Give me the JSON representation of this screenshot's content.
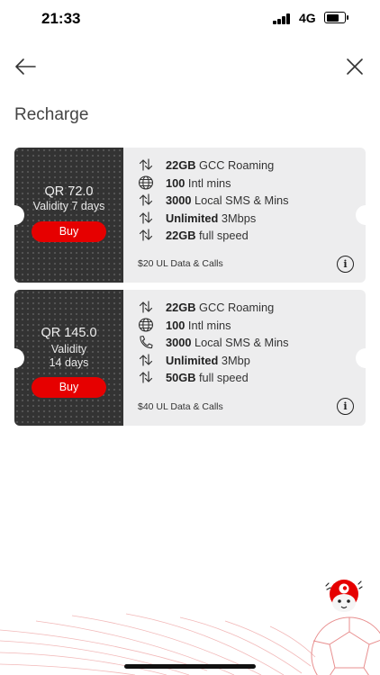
{
  "status_bar": {
    "time": "21:33",
    "network": "4G"
  },
  "header": {
    "title": "Recharge"
  },
  "colors": {
    "accent": "#e60000",
    "card_dark": "#333333",
    "card_light": "#ededee"
  },
  "plans": [
    {
      "price": "QR 72.0",
      "validity": "Validity 7 days",
      "buy_label": "Buy",
      "description": "$20 UL Data & Calls",
      "features": [
        {
          "icon": "roaming-arrows-icon",
          "bold": "22GB",
          "text": "GCC Roaming"
        },
        {
          "icon": "globe-icon",
          "bold": "100",
          "text": "Intl mins"
        },
        {
          "icon": "roaming-arrows-icon",
          "bold": "3000",
          "text": "Local SMS & Mins"
        },
        {
          "icon": "roaming-arrows-icon",
          "bold": "Unlimited",
          "text": "3Mbps"
        },
        {
          "icon": "roaming-arrows-icon",
          "bold": "22GB",
          "text": "full speed"
        }
      ]
    },
    {
      "price": "QR 145.0",
      "validity_line1": "Validity",
      "validity_line2": "14 days",
      "buy_label": "Buy",
      "description": "$40 UL Data & Calls",
      "features": [
        {
          "icon": "roaming-arrows-icon",
          "bold": "22GB",
          "text": "GCC Roaming"
        },
        {
          "icon": "globe-icon",
          "bold": "100",
          "text": "Intl mins"
        },
        {
          "icon": "phone-icon",
          "bold": "3000",
          "text": "Local SMS & Mins"
        },
        {
          "icon": "roaming-arrows-icon",
          "bold": "Unlimited",
          "text": "3Mbp"
        },
        {
          "icon": "roaming-arrows-icon",
          "bold": "50GB",
          "text": "full speed"
        }
      ]
    }
  ],
  "info_symbol": "i"
}
